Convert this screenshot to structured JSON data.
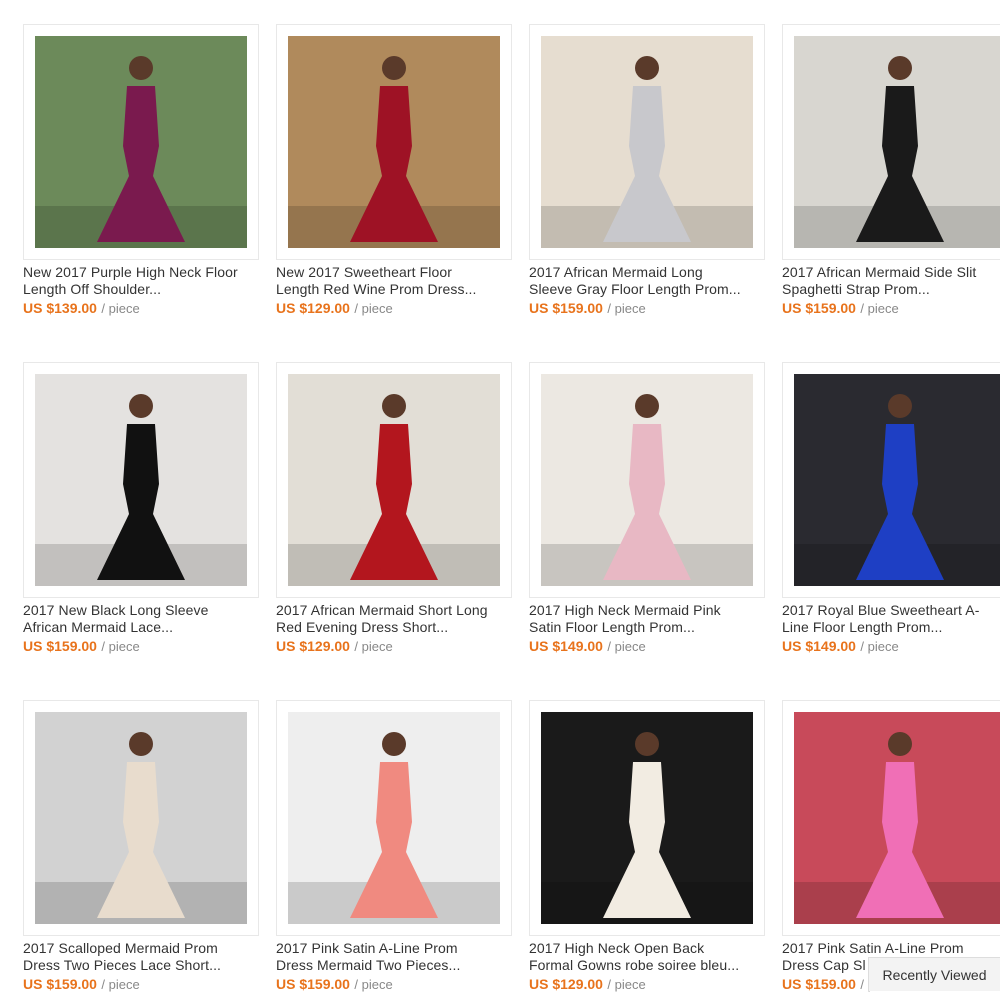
{
  "products": [
    {
      "title_line1": "New 2017 Purple High Neck Floor",
      "title_line2": "Length Off Shoulder...",
      "price": "US $139.00",
      "unit": "/ piece",
      "dress_color": "#7a1a4e",
      "bg_color": "#6c8a5a"
    },
    {
      "title_line1": "New 2017 Sweetheart Floor",
      "title_line2": "Length Red Wine Prom Dress...",
      "price": "US $129.00",
      "unit": "/ piece",
      "dress_color": "#9e1225",
      "bg_color": "#b08a5c"
    },
    {
      "title_line1": "2017 African Mermaid Long",
      "title_line2": "Sleeve Gray Floor Length Prom...",
      "price": "US $159.00",
      "unit": "/ piece",
      "dress_color": "#c8c8cc",
      "bg_color": "#e6ddd0"
    },
    {
      "title_line1": "2017 African Mermaid Side Slit",
      "title_line2": "Spaghetti Strap Prom...",
      "price": "US $159.00",
      "unit": "/ piece",
      "dress_color": "#1a1a1a",
      "bg_color": "#d8d6d0"
    },
    {
      "title_line1": "2017 New Black Long Sleeve",
      "title_line2": "African Mermaid Lace...",
      "price": "US $159.00",
      "unit": "/ piece",
      "dress_color": "#111111",
      "bg_color": "#e4e2e0"
    },
    {
      "title_line1": "2017 African Mermaid Short Long",
      "title_line2": "Red Evening Dress Short...",
      "price": "US $129.00",
      "unit": "/ piece",
      "dress_color": "#b3161e",
      "bg_color": "#e2ded6"
    },
    {
      "title_line1": "2017 High Neck Mermaid Pink",
      "title_line2": "Satin Floor Length Prom...",
      "price": "US $149.00",
      "unit": "/ piece",
      "dress_color": "#e8b8c4",
      "bg_color": "#ece8e2"
    },
    {
      "title_line1": "2017 Royal Blue Sweetheart A-",
      "title_line2": "Line Floor Length Prom...",
      "price": "US $149.00",
      "unit": "/ piece",
      "dress_color": "#1e3fc4",
      "bg_color": "#2a2a30"
    },
    {
      "title_line1": "2017 Scalloped Mermaid Prom",
      "title_line2": "Dress Two Pieces Lace Short...",
      "price": "US $159.00",
      "unit": "/ piece",
      "dress_color": "#e8dccd",
      "bg_color": "#d2d2d2"
    },
    {
      "title_line1": "2017 Pink Satin A-Line Prom",
      "title_line2": "Dress Mermaid Two Pieces...",
      "price": "US $159.00",
      "unit": "/ piece",
      "dress_color": "#f08a80",
      "bg_color": "#eeeeee"
    },
    {
      "title_line1": "2017 High Neck Open Back",
      "title_line2": "Formal Gowns robe soiree bleu...",
      "price": "US $129.00",
      "unit": "/ piece",
      "dress_color": "#f2ece2",
      "bg_color": "#1a1a1a"
    },
    {
      "title_line1": "2017 Pink Satin A-Line Prom",
      "title_line2": "Dress Cap Sl",
      "price": "US $159.00",
      "unit": "/ piece",
      "dress_color": "#f06fb6",
      "bg_color": "#c84a5a"
    }
  ],
  "recently_viewed": {
    "label": "Recently Viewed"
  }
}
